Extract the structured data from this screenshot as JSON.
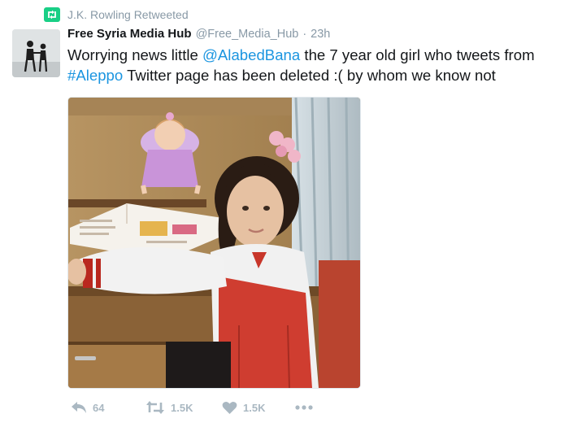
{
  "retweet_context": {
    "label": "J.K. Rowling Retweeted",
    "icon": "retweet-icon"
  },
  "tweet": {
    "author": {
      "name": "Free Syria Media Hub",
      "handle": "@Free_Media_Hub"
    },
    "separator": "·",
    "time": "23h",
    "text": {
      "part1": "Worrying news little ",
      "mention": "@AlabedBana",
      "part2": " the 7 year old girl who tweets from ",
      "hashtag": "#Aleppo",
      "part3": " Twitter page has been deleted :( by whom we know not"
    }
  },
  "actions": {
    "reply": {
      "icon": "reply-icon",
      "count": "64"
    },
    "retweet": {
      "icon": "retweet-icon",
      "count": "1.5K"
    },
    "like": {
      "icon": "heart-icon",
      "count": "1.5K"
    },
    "more": {
      "icon": "more-icon"
    }
  },
  "colors": {
    "accent_link": "#1b95e0",
    "retweet_badge": "#19cf86",
    "muted_text": "#8899a6",
    "action_icons": "#aab8c2"
  }
}
